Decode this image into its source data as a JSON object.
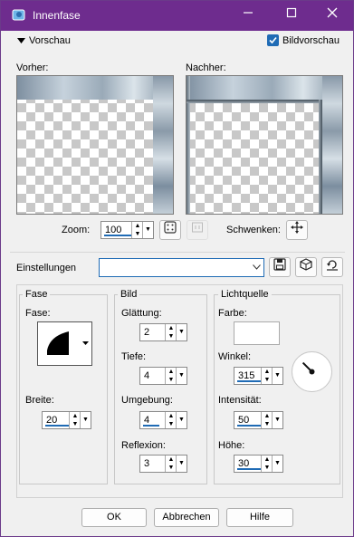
{
  "window": {
    "title": "Innenfase"
  },
  "preview_section": {
    "toggle_label": "Vorschau",
    "preview_checkbox_label": "Bildvorschau",
    "preview_checked": true,
    "before_label": "Vorher:",
    "after_label": "Nachher:",
    "zoom_label": "Zoom:",
    "zoom_value": "100",
    "pan_label": "Schwenken:"
  },
  "settings": {
    "label": "Einstellungen",
    "value": ""
  },
  "fase_group": {
    "title": "Fase",
    "fase_label": "Fase:",
    "breite_label": "Breite:",
    "breite_value": "20",
    "breite_level": 0.4
  },
  "bild_group": {
    "title": "Bild",
    "glaettung_label": "Glättung:",
    "glaettung_value": "2",
    "tiefe_label": "Tiefe:",
    "tiefe_value": "4",
    "umgebung_label": "Umgebung:",
    "umgebung_value": "4",
    "reflexion_label": "Reflexion:",
    "reflexion_value": "3"
  },
  "licht_group": {
    "title": "Lichtquelle",
    "farbe_label": "Farbe:",
    "farbe_color": "#ffffff",
    "winkel_label": "Winkel:",
    "winkel_value": "315",
    "intensitaet_label": "Intensität:",
    "intensitaet_value": "50",
    "hoehe_label": "Höhe:",
    "hoehe_value": "30"
  },
  "buttons": {
    "ok": "OK",
    "cancel": "Abbrechen",
    "help": "Hilfe"
  },
  "colors": {
    "titlebar": "#6e2c8e",
    "accent": "#1f6bb5"
  }
}
